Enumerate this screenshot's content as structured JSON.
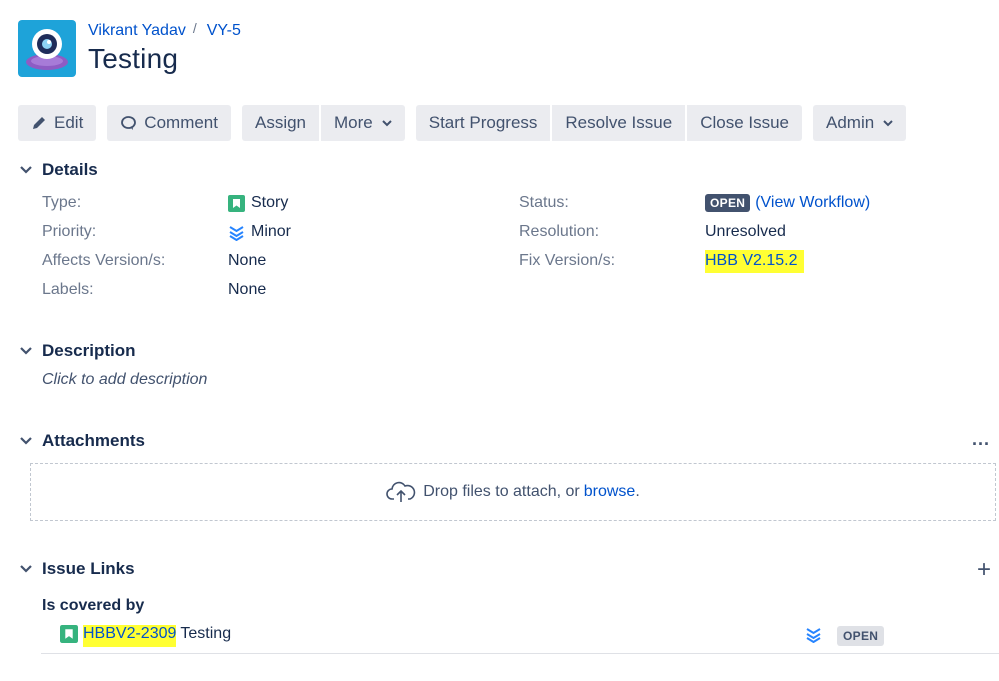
{
  "breadcrumb": {
    "project": "Vikrant Yadav",
    "separator": "/",
    "issue_key": "VY-5"
  },
  "title": "Testing",
  "toolbar": {
    "edit": "Edit",
    "comment": "Comment",
    "assign": "Assign",
    "more": "More",
    "start_progress": "Start Progress",
    "resolve_issue": "Resolve Issue",
    "close_issue": "Close Issue",
    "admin": "Admin"
  },
  "details": {
    "heading": "Details",
    "type_label": "Type:",
    "type_value": "Story",
    "priority_label": "Priority:",
    "priority_value": "Minor",
    "affects_label": "Affects Version/s:",
    "affects_value": "None",
    "labels_label": "Labels:",
    "labels_value": "None",
    "status_label": "Status:",
    "status_value": "OPEN",
    "view_workflow": "(View Workflow)",
    "resolution_label": "Resolution:",
    "resolution_value": "Unresolved",
    "fix_label": "Fix Version/s:",
    "fix_value": "HBB V2.15.2"
  },
  "description": {
    "heading": "Description",
    "placeholder": "Click to add description"
  },
  "attachments": {
    "heading": "Attachments",
    "more": "...",
    "drop_text": "Drop files to attach, or ",
    "browse": "browse",
    "period": "."
  },
  "issue_links": {
    "heading": "Issue Links",
    "add": "+",
    "relation": "Is covered by",
    "items": [
      {
        "key": "HBBV2-2309",
        "summary": "Testing",
        "status": "OPEN"
      }
    ]
  },
  "colors": {
    "link": "#0052cc",
    "highlight": "#ffff33",
    "story": "#36b37e",
    "priority_minor": "#2684ff",
    "avatar": "#1ea3d9"
  }
}
